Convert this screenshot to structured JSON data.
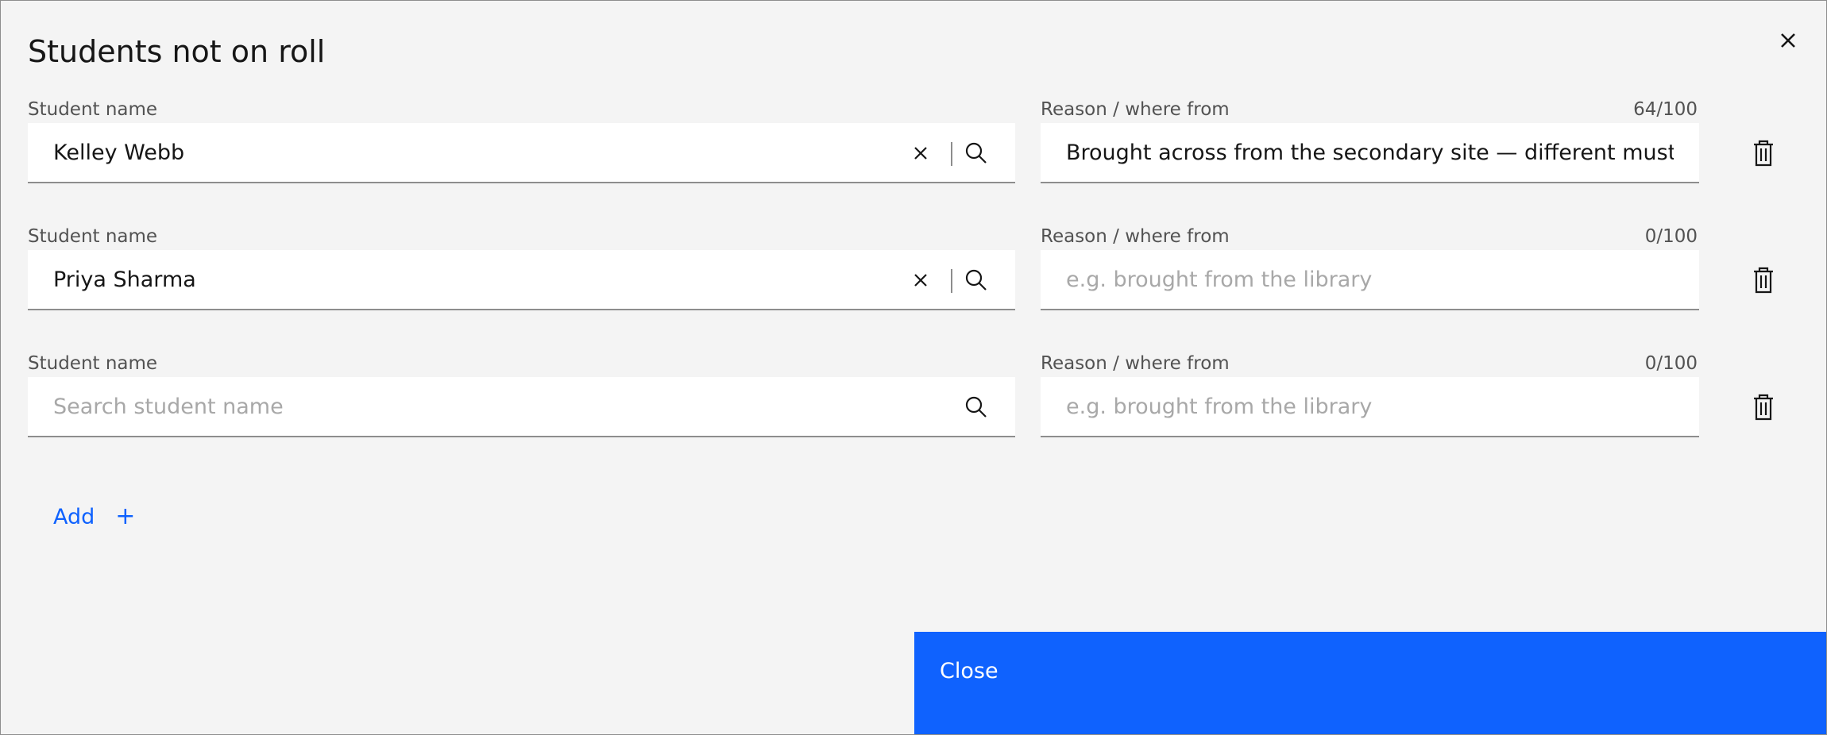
{
  "modal": {
    "title": "Students not on roll",
    "close_icon": "close-icon"
  },
  "labels": {
    "student_name": "Student name",
    "reason": "Reason / where from"
  },
  "rows": [
    {
      "student_value": "Kelley Webb",
      "student_placeholder": "Search student name",
      "reason_value": "Brought across from the secondary site — different muster point",
      "reason_placeholder": "e.g. brought from the library",
      "counter": "64/100"
    },
    {
      "student_value": "Priya Sharma",
      "student_placeholder": "Search student name",
      "reason_value": "",
      "reason_placeholder": "e.g. brought from the library",
      "counter": "0/100"
    },
    {
      "student_value": "",
      "student_placeholder": "Search student name",
      "reason_value": "",
      "reason_placeholder": "e.g. brought from the library",
      "counter": "0/100"
    }
  ],
  "actions": {
    "add_label": "Add",
    "add_icon": "+",
    "close_label": "Close"
  },
  "colors": {
    "primary": "#0f62fe",
    "background": "#f4f4f4",
    "field": "#ffffff"
  }
}
